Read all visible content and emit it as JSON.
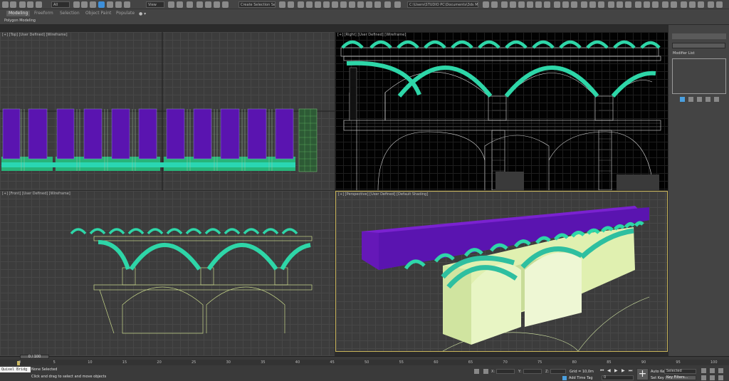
{
  "toolbar": {
    "selection_filter": "All",
    "view_dropdown": "View",
    "selection_set": "Create Selection Se",
    "project_path": "C:\\Users\\STUDIO PC\\Documents\\3ds Max 2020"
  },
  "ribbon": {
    "tabs": [
      "Modeling",
      "Freeform",
      "Selection",
      "Object Paint",
      "Populate"
    ],
    "sub_label": "Polygon Modeling"
  },
  "viewports": {
    "top": "[+] [Top] [User Defined] [Wireframe]",
    "right": "[+] [Right] [User Defined] [Wireframe]",
    "front": "[+] [Front] [User Defined] [Wireframe]",
    "perspective": "[+] [Perspective] [User Defined] [Default Shading]"
  },
  "command_panel": {
    "modifier_list": "Modifier List"
  },
  "timeline": {
    "frame_display": "0 / 100",
    "ticks": [
      "0",
      "5",
      "10",
      "15",
      "20",
      "25",
      "30",
      "35",
      "40",
      "45",
      "50",
      "55",
      "60",
      "65",
      "70",
      "75",
      "80",
      "85",
      "90",
      "95",
      "100"
    ]
  },
  "status": {
    "maxscript": "Quixel Bridg",
    "selection_status": "None Selected",
    "prompt": "Click and drag to select and move objects",
    "x_label": "X:",
    "y_label": "Y:",
    "z_label": "Z:",
    "grid": "Grid = 10,0m",
    "add_time_tag": "Add Time Tag",
    "auto_key": "Auto Key",
    "set_key": "Set Key",
    "key_mode": "Selected",
    "key_filters": "Key Filters...",
    "frame_field": "0"
  },
  "colors": {
    "ui_bg": "#444444",
    "viewport_bg": "#3c3c3c",
    "wire_bg": "#020202",
    "purple": "#5a14b0",
    "teal": "#2ecfa0",
    "pale_green": "#d6eaa6",
    "active_border": "#c9b55a"
  }
}
